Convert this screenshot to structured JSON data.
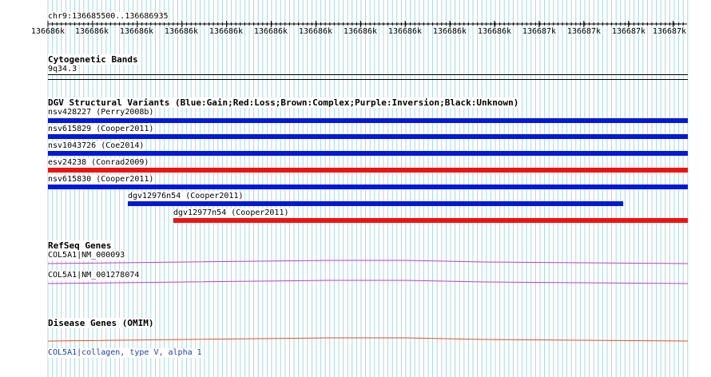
{
  "ruler": {
    "location": "chr9:136685500..136686935",
    "tick_labels": [
      "136686k",
      "136686k",
      "136686k",
      "136686k",
      "136686k",
      "136686k",
      "136686k",
      "136686k",
      "136686k",
      "136686k",
      "136686k",
      "136687k",
      "136687k",
      "136687k",
      "136687k"
    ]
  },
  "cytobands": {
    "title": "Cytogenetic Bands",
    "band": "9q34.3"
  },
  "dgv": {
    "title": "DGV Structural Variants (Blue:Gain;Red:Loss;Brown:Complex;Purple:Inversion;Black:Unknown)",
    "variants": [
      {
        "label": "nsv428227 (Perry2008b)",
        "color": "#0019d6"
      },
      {
        "label": "nsv615829 (Cooper2011)",
        "color": "#0019d6"
      },
      {
        "label": "nsv1043726 (Coe2014)",
        "color": "#0019d6"
      },
      {
        "label": "esv24238 (Conrad2009)",
        "color": "#ef1212"
      },
      {
        "label": "nsv615830 (Cooper2011)",
        "color": "#0019d6"
      },
      {
        "label": "dgv12976n54 (Cooper2011)",
        "color": "#0019d6"
      },
      {
        "label": "dgv12977n54 (Cooper2011)",
        "color": "#ef1212"
      }
    ]
  },
  "refseq": {
    "title": "RefSeq Genes",
    "genes": [
      {
        "label": "COL5A1|NM_000093",
        "color": "#c040c0"
      },
      {
        "label": "COL5A1|NM_001278074",
        "color": "#c040c0"
      }
    ]
  },
  "omim": {
    "title": "Disease Genes (OMIM)",
    "gene": "COL5A1|collagen, type V, alpha 1",
    "color": "#e05030",
    "link_color": "#1a3fa8"
  },
  "colors": {
    "grid": "#a8d8e0",
    "gain": "#0019d6",
    "loss": "#ef1212"
  }
}
